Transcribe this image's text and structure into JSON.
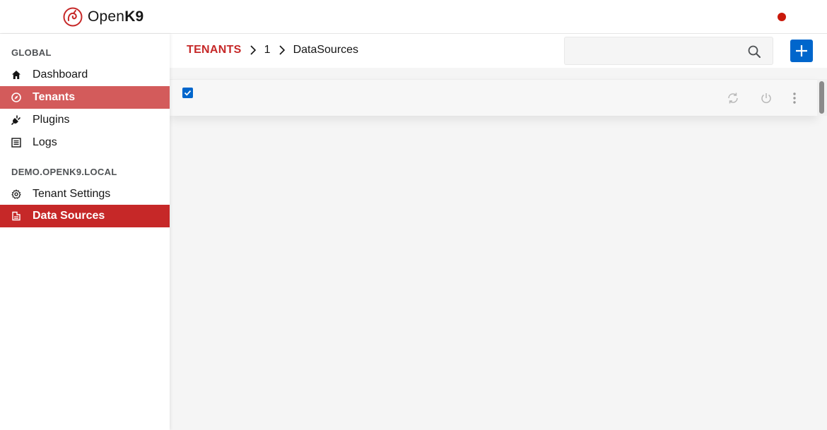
{
  "app": {
    "logo_prefix": "Open",
    "logo_suffix": "K9",
    "status_color": "#c9190b"
  },
  "sidebar": {
    "sections": [
      {
        "title": "GLOBAL",
        "items": [
          {
            "label": "Dashboard",
            "icon": "home-icon",
            "active": false
          },
          {
            "label": "Tenants",
            "icon": "compass-icon",
            "active": true
          },
          {
            "label": "Plugins",
            "icon": "plug-icon",
            "active": false
          },
          {
            "label": "Logs",
            "icon": "list-icon",
            "active": false
          }
        ]
      },
      {
        "title": "DEMO.OPENK9.LOCAL",
        "items": [
          {
            "label": "Tenant Settings",
            "icon": "gear-icon",
            "active": false
          },
          {
            "label": "Data Sources",
            "icon": "datasource-icon",
            "active": true
          }
        ]
      }
    ]
  },
  "breadcrumb": {
    "items": [
      "TENANTS",
      "1",
      "DataSources"
    ]
  },
  "search": {
    "placeholder": "",
    "value": ""
  },
  "toolbar": {
    "add_icon": "plus-icon"
  },
  "table": {
    "select_all_checked": true,
    "actions": [
      "refresh-icon",
      "power-icon",
      "kebab-icon"
    ]
  },
  "colors": {
    "brand": "#c62828",
    "active_light": "#d35b5b",
    "primary": "#0066cc"
  }
}
